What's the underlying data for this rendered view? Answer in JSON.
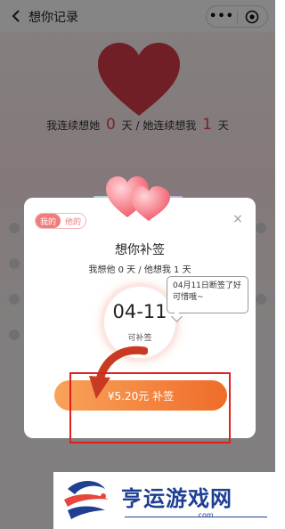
{
  "nav": {
    "title": "想你记录",
    "more": "•••"
  },
  "streak": {
    "prefix": "我连续想她",
    "days_her": "0",
    "mid": "天 / 她连续想我",
    "days_me": "1",
    "suffix": "天"
  },
  "modal": {
    "tab_mine": "我的",
    "tab_theirs": "他的",
    "close": "×",
    "title": "想你补签",
    "subtitle": "我想他 0 天 / 他想我 1 天",
    "date": "04-11",
    "date_status": "可补签",
    "tooltip": "04月11日断签了好可惜哦~",
    "pay_button": "¥5.20元 补签"
  },
  "watermark": {
    "name": "亨运游戏网",
    "domain": ".com"
  },
  "colors": {
    "accent": "#f06c2a",
    "heart": "#d93c4a",
    "annotation": "#e02020"
  }
}
